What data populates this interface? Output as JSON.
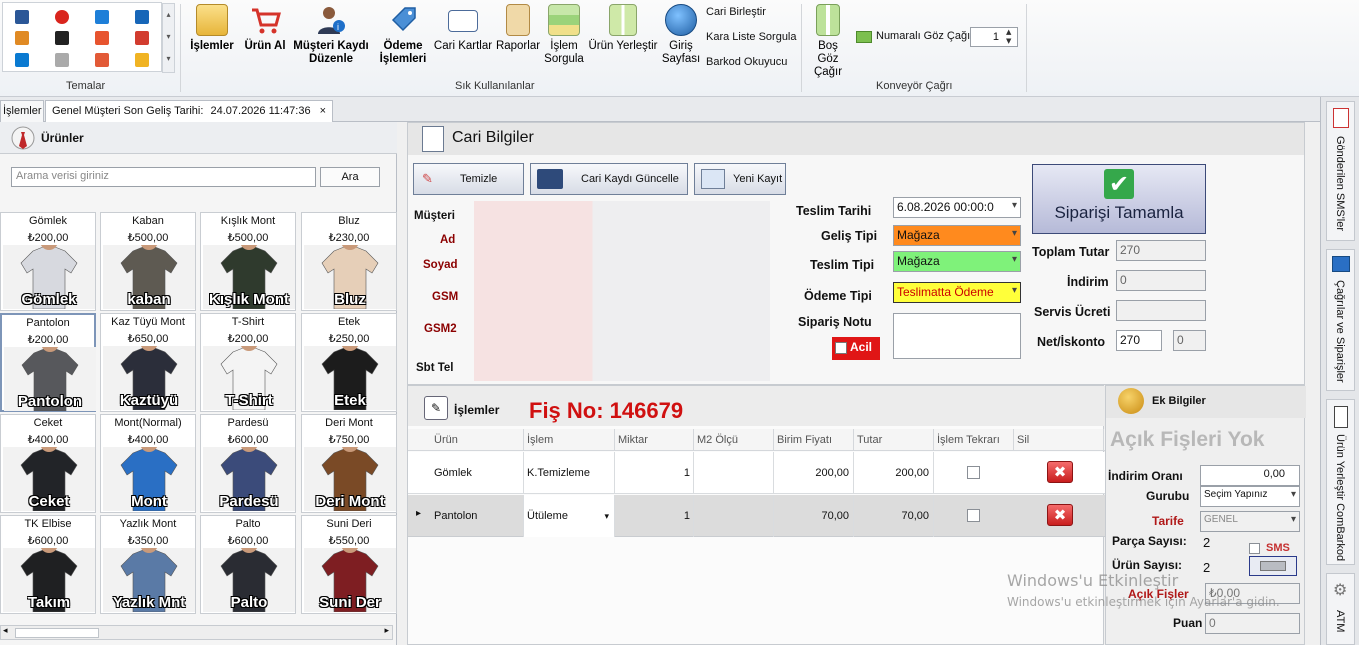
{
  "ribbon": {
    "themes_label": "Temalar",
    "frequent_label": "Sık Kullanılanlar",
    "conveyor_label": "Konveyör Çağrı",
    "buttons": [
      {
        "label1": "İşlemler",
        "label2": "",
        "icon": "notepad-icon"
      },
      {
        "label1": "Ürün Al",
        "label2": "",
        "icon": "cart-icon"
      },
      {
        "label1": "Müşteri Kaydı",
        "label2": "Düzenle",
        "icon": "customer-info-icon"
      },
      {
        "label1": "Ödeme",
        "label2": "İşlemleri",
        "icon": "tag-icon"
      },
      {
        "label1": "Cari Kartlar",
        "label2": "",
        "icon": "id-card-icon"
      },
      {
        "label1": "Raporlar",
        "label2": "",
        "icon": "clipboard-report-icon"
      },
      {
        "label1": "İşlem",
        "label2": "Sorgula",
        "icon": "spreadsheet-icon"
      },
      {
        "label1": "Ürün Yerleştir",
        "label2": "",
        "icon": "panel-icon"
      },
      {
        "label1": "Giriş",
        "label2": "Sayfası",
        "icon": "globe-icon"
      }
    ],
    "small_items": [
      "Cari Birleştir",
      "Kara Liste Sorgula",
      "Barkod Okuyucu"
    ],
    "bos_goz": {
      "label1": "Boş Göz",
      "label2": "Çağır"
    },
    "numarali": "Numaralı Göz Çağır",
    "numarali_value": "1"
  },
  "tabs": {
    "islemler": "İşlemler",
    "genel": "Genel Müşteri Son Geliş Tarihi:",
    "date": "24.07.2026 11:47:36",
    "close": "×"
  },
  "products": {
    "title": "Ürünler",
    "search_placeholder": "Arama verisi giriniz",
    "search_button": "Ara",
    "items": [
      {
        "name": "Gömlek",
        "price": "₺200,00",
        "caption": "Gömlek",
        "color": "#d7d9df"
      },
      {
        "name": "Kaban",
        "price": "₺500,00",
        "caption": "kaban",
        "color": "#5e5a52"
      },
      {
        "name": "Kışlık Mont",
        "price": "₺500,00",
        "caption": "Kışlık Mont",
        "color": "#2f3a2d"
      },
      {
        "name": "Bluz",
        "price": "₺230,00",
        "caption": "Bluz",
        "color": "#e6cfb8"
      },
      {
        "name": "Pantolon",
        "price": "₺200,00",
        "caption": "Pantolon",
        "color": "#57585c"
      },
      {
        "name": "Kaz Tüyü Mont",
        "price": "₺650,00",
        "caption": "Kaztüyü",
        "color": "#2b2e3a"
      },
      {
        "name": "T-Shirt",
        "price": "₺200,00",
        "caption": "T-Shirt",
        "color": "#f4f4f4"
      },
      {
        "name": "Etek",
        "price": "₺250,00",
        "caption": "Etek",
        "color": "#1c1c1c"
      },
      {
        "name": "Ceket",
        "price": "₺400,00",
        "caption": "Ceket",
        "color": "#222428"
      },
      {
        "name": "Mont(Normal)",
        "price": "₺400,00",
        "caption": "Mont",
        "color": "#2a6fc4"
      },
      {
        "name": "Pardesü",
        "price": "₺600,00",
        "caption": "Pardesü",
        "color": "#3b4b7a"
      },
      {
        "name": "Deri Mont",
        "price": "₺750,00",
        "caption": "Deri Mont",
        "color": "#7a4a26"
      },
      {
        "name": "TK Elbise",
        "price": "₺600,00",
        "caption": "Takım",
        "color": "#1f2022"
      },
      {
        "name": "Yazlık Mont",
        "price": "₺350,00",
        "caption": "Yazlık Mnt",
        "color": "#5a7aa6"
      },
      {
        "name": "Palto",
        "price": "₺600,00",
        "caption": "Palto",
        "color": "#2a2c33"
      },
      {
        "name": "Suni Deri",
        "price": "₺550,00",
        "caption": "Suni Der",
        "color": "#7e1e22"
      }
    ]
  },
  "cari": {
    "title": "Cari Bilgiler",
    "btn_temizle": "Temizle",
    "btn_guncelle": "Cari Kaydı Güncelle",
    "btn_yeni": "Yeni Kayıt",
    "labels": {
      "musteri": "Müşteri",
      "ad": "Ad",
      "soyad": "Soyad",
      "gsm": "GSM",
      "gsm2": "GSM2",
      "sbt": "Sbt Tel"
    },
    "teslim_tarihi_label": "Teslim Tarihi",
    "teslim_tarihi": "6.08.2026 00:00:0",
    "gelis_tipi_label": "Geliş Tipi",
    "gelis_tipi": "Mağaza",
    "teslim_tipi_label": "Teslim Tipi",
    "teslim_tipi": "Mağaza",
    "odeme_tipi_label": "Ödeme Tipi",
    "odeme_tipi": "Teslimatta Ödeme",
    "siparis_notu_label": "Sipariş Notu",
    "acil": "Acil",
    "tamamla": "Siparişi Tamamla",
    "toplam_label": "Toplam Tutar",
    "toplam": "270",
    "indirim_label": "İndirim",
    "indirim": "0",
    "servis_label": "Servis Ücreti",
    "servis": "",
    "net_label": "Net/İskonto",
    "net": "270",
    "iskonto": "0"
  },
  "islemler": {
    "title": "İşlemler",
    "fis_no": "Fiş No:  146679",
    "columns": [
      "Ürün",
      "İşlem",
      "Miktar",
      "M2 Ölçü",
      "Birim Fiyatı",
      "Tutar",
      "İşlem Tekrarı",
      "Sil"
    ],
    "rows": [
      {
        "urun": "Gömlek",
        "islem": "K.Temizleme",
        "miktar": "1",
        "m2": "",
        "birim": "200,00",
        "tutar": "200,00"
      },
      {
        "urun": "Pantolon",
        "islem": "Ütüleme",
        "miktar": "1",
        "m2": "",
        "birim": "70,00",
        "tutar": "70,00"
      }
    ],
    "delete_glyph": "✖",
    "row_marker": "▸"
  },
  "ek": {
    "title": "Ek Bilgiler",
    "acik_fis_yok": "Açık Fişleri Yok",
    "indirim_orani_label": "İndirim Oranı",
    "indirim_orani": "0,00",
    "gurubu_label": "Gurubu",
    "gurubu": "Seçim Yapınız",
    "tarife_label": "Tarife",
    "tarife": "GENEL",
    "parca_label": "Parça Sayısı:",
    "parca": "2",
    "urun_label": "Ürün Sayısı:",
    "urun": "2",
    "sms": "SMS",
    "acik_fisler_label": "Açık Fişler",
    "acik_fisler": "₺0,00",
    "puan_label": "Puan",
    "puan": "0"
  },
  "sidebar": [
    "Gönderilen SMS'ler",
    "Çağrılar ve Siparişler",
    "Ürün Yerleştir ComBarkod",
    "ATM"
  ],
  "watermark": {
    "line1": "Windows'u Etkinleştir",
    "line2": "Windows'u etkinleştirmek için Ayarlar'a gidin."
  }
}
